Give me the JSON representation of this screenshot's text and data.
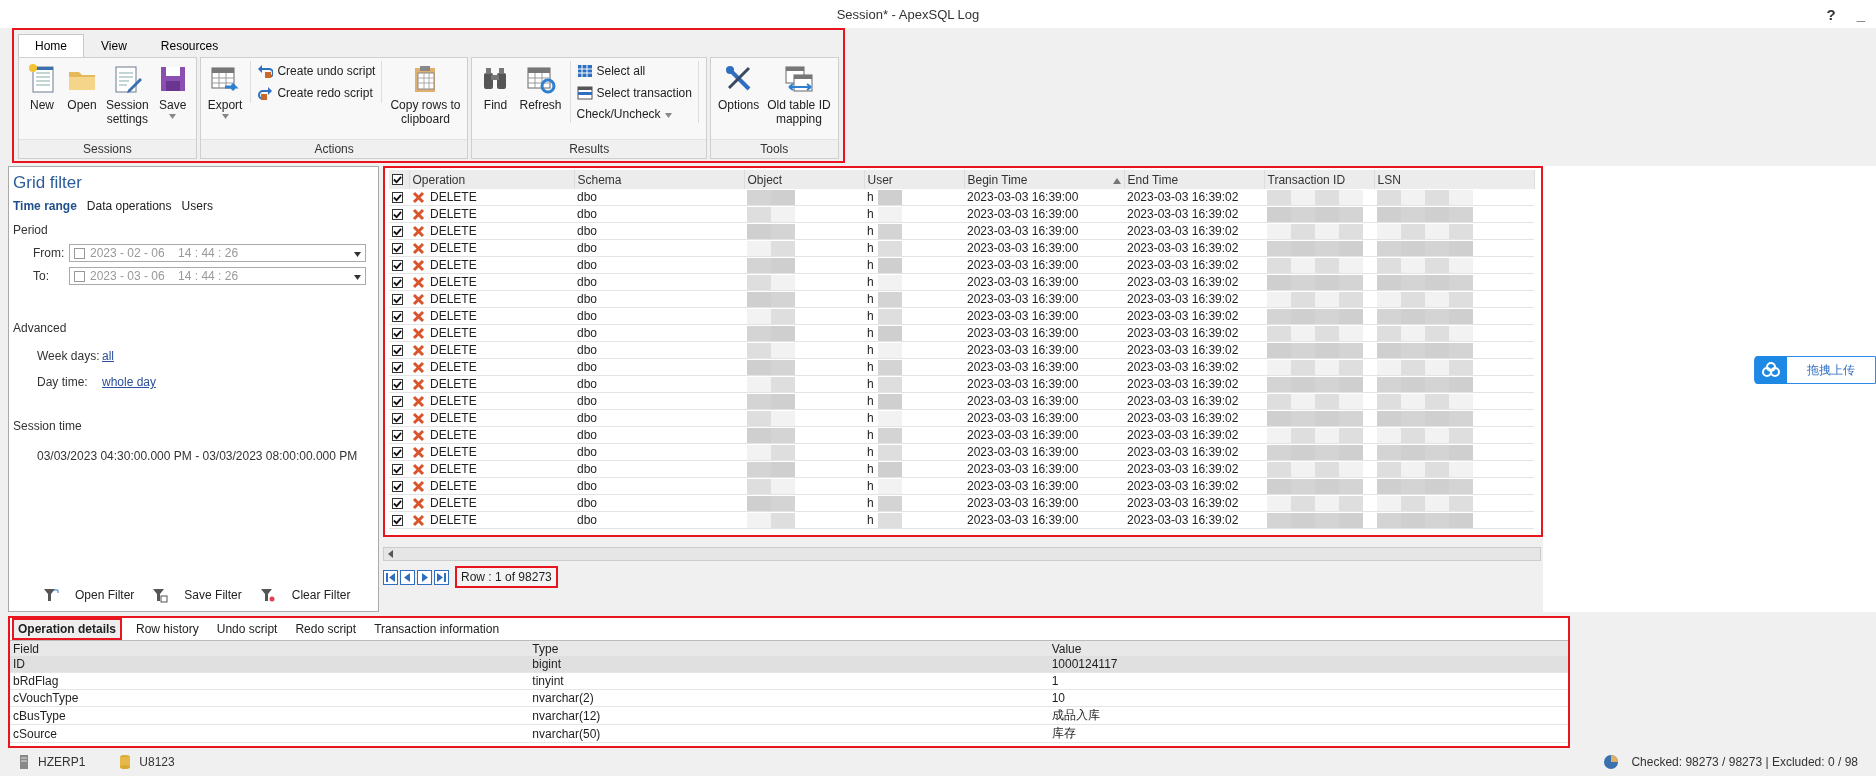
{
  "window": {
    "title": "Session* - ApexSQL Log",
    "help": "?",
    "minimize": "_"
  },
  "ribbon": {
    "tabs": [
      {
        "label": "Home",
        "selected": true
      },
      {
        "label": "View",
        "selected": false
      },
      {
        "label": "Resources",
        "selected": false
      }
    ],
    "groups": [
      {
        "name": "Sessions",
        "items": [
          {
            "kind": "large",
            "label": "New"
          },
          {
            "kind": "large",
            "label": "Open"
          },
          {
            "kind": "large",
            "label": "Session\nsettings"
          },
          {
            "kind": "large",
            "label": "Save",
            "has_menu": true
          }
        ]
      },
      {
        "name": "Actions",
        "items": [
          {
            "kind": "large",
            "label": "Export",
            "has_menu": true
          },
          {
            "kind": "stack",
            "items": [
              {
                "label": "Create undo script"
              },
              {
                "label": "Create redo script"
              }
            ]
          },
          {
            "kind": "large",
            "label": "Copy rows to\nclipboard"
          }
        ]
      },
      {
        "name": "Results",
        "items": [
          {
            "kind": "large",
            "label": "Find"
          },
          {
            "kind": "large",
            "label": "Refresh"
          },
          {
            "kind": "stack",
            "items": [
              {
                "label": "Select all"
              },
              {
                "label": "Select transaction"
              },
              {
                "label": "Check/Uncheck",
                "has_menu": true
              }
            ]
          }
        ]
      },
      {
        "name": "Tools",
        "items": [
          {
            "kind": "large",
            "label": "Options"
          },
          {
            "kind": "large",
            "label": "Old table ID\nmapping"
          }
        ]
      }
    ]
  },
  "filter": {
    "title": "Grid filter",
    "tabs": [
      {
        "label": "Time range",
        "selected": true
      },
      {
        "label": "Data operations",
        "selected": false
      },
      {
        "label": "Users",
        "selected": false
      }
    ],
    "period_label": "Period",
    "period": [
      {
        "label": "From:",
        "checked": false,
        "disabled": true,
        "value": "2023 - 02 - 06    14 : 44 : 26"
      },
      {
        "label": "To:",
        "checked": false,
        "disabled": true,
        "value": "2023 - 03 - 06    14 : 44 : 26"
      }
    ],
    "advanced_label": "Advanced",
    "advanced": [
      {
        "label": "Week days:",
        "link": "all"
      },
      {
        "label": "Day time:",
        "link": "whole day"
      }
    ],
    "session_label": "Session time",
    "session_time": "03/03/2023 04:30:00.000 PM - 03/03/2023 08:00:00.000 PM",
    "actions": [
      "Open Filter",
      "Save Filter",
      "Clear Filter"
    ]
  },
  "grid": {
    "all_checked": true,
    "columns": [
      {
        "label": "Operation"
      },
      {
        "label": "Schema"
      },
      {
        "label": "Object"
      },
      {
        "label": "User"
      },
      {
        "label": "Begin Time",
        "sorted": true
      },
      {
        "label": "End Time"
      },
      {
        "label": "Transaction ID"
      },
      {
        "label": "LSN"
      }
    ],
    "rows": [
      {
        "checked": true,
        "operation": "DELETE",
        "schema": "dbo",
        "user": "h",
        "begin": "2023-03-03 16:39:00",
        "end": "2023-03-03 16:39:02"
      },
      {
        "checked": true,
        "operation": "DELETE",
        "schema": "dbo",
        "user": "h",
        "begin": "2023-03-03 16:39:00",
        "end": "2023-03-03 16:39:02"
      },
      {
        "checked": true,
        "operation": "DELETE",
        "schema": "dbo",
        "user": "h",
        "begin": "2023-03-03 16:39:00",
        "end": "2023-03-03 16:39:02"
      },
      {
        "checked": true,
        "operation": "DELETE",
        "schema": "dbo",
        "user": "h",
        "begin": "2023-03-03 16:39:00",
        "end": "2023-03-03 16:39:02"
      },
      {
        "checked": true,
        "operation": "DELETE",
        "schema": "dbo",
        "user": "h",
        "begin": "2023-03-03 16:39:00",
        "end": "2023-03-03 16:39:02"
      },
      {
        "checked": true,
        "operation": "DELETE",
        "schema": "dbo",
        "user": "h",
        "begin": "2023-03-03 16:39:00",
        "end": "2023-03-03 16:39:02"
      },
      {
        "checked": true,
        "operation": "DELETE",
        "schema": "dbo",
        "user": "h",
        "begin": "2023-03-03 16:39:00",
        "end": "2023-03-03 16:39:02"
      },
      {
        "checked": true,
        "operation": "DELETE",
        "schema": "dbo",
        "user": "h",
        "begin": "2023-03-03 16:39:00",
        "end": "2023-03-03 16:39:02"
      },
      {
        "checked": true,
        "operation": "DELETE",
        "schema": "dbo",
        "user": "h",
        "begin": "2023-03-03 16:39:00",
        "end": "2023-03-03 16:39:02"
      },
      {
        "checked": true,
        "operation": "DELETE",
        "schema": "dbo",
        "user": "h",
        "begin": "2023-03-03 16:39:00",
        "end": "2023-03-03 16:39:02"
      },
      {
        "checked": true,
        "operation": "DELETE",
        "schema": "dbo",
        "user": "h",
        "begin": "2023-03-03 16:39:00",
        "end": "2023-03-03 16:39:02"
      },
      {
        "checked": true,
        "operation": "DELETE",
        "schema": "dbo",
        "user": "h",
        "begin": "2023-03-03 16:39:00",
        "end": "2023-03-03 16:39:02"
      },
      {
        "checked": true,
        "operation": "DELETE",
        "schema": "dbo",
        "user": "h",
        "begin": "2023-03-03 16:39:00",
        "end": "2023-03-03 16:39:02"
      },
      {
        "checked": true,
        "operation": "DELETE",
        "schema": "dbo",
        "user": "h",
        "begin": "2023-03-03 16:39:00",
        "end": "2023-03-03 16:39:02"
      },
      {
        "checked": true,
        "operation": "DELETE",
        "schema": "dbo",
        "user": "h",
        "begin": "2023-03-03 16:39:00",
        "end": "2023-03-03 16:39:02"
      },
      {
        "checked": true,
        "operation": "DELETE",
        "schema": "dbo",
        "user": "h",
        "begin": "2023-03-03 16:39:00",
        "end": "2023-03-03 16:39:02"
      },
      {
        "checked": true,
        "operation": "DELETE",
        "schema": "dbo",
        "user": "h",
        "begin": "2023-03-03 16:39:00",
        "end": "2023-03-03 16:39:02"
      },
      {
        "checked": true,
        "operation": "DELETE",
        "schema": "dbo",
        "user": "h",
        "begin": "2023-03-03 16:39:00",
        "end": "2023-03-03 16:39:02"
      },
      {
        "checked": true,
        "operation": "DELETE",
        "schema": "dbo",
        "user": "h",
        "begin": "2023-03-03 16:39:00",
        "end": "2023-03-03 16:39:02"
      },
      {
        "checked": true,
        "operation": "DELETE",
        "schema": "dbo",
        "user": "h",
        "begin": "2023-03-03 16:39:00",
        "end": "2023-03-03 16:39:02"
      }
    ]
  },
  "navigator": {
    "row_info": "Row : 1 of 98273"
  },
  "details": {
    "tabs": [
      {
        "label": "Operation details",
        "selected": true
      },
      {
        "label": "Row history",
        "selected": false
      },
      {
        "label": "Undo script",
        "selected": false
      },
      {
        "label": "Redo script",
        "selected": false
      },
      {
        "label": "Transaction information",
        "selected": false
      }
    ],
    "columns": [
      "Field",
      "Type",
      "Value"
    ],
    "rows": [
      {
        "field": "ID",
        "type": "bigint",
        "value": "1000124117",
        "selected": true
      },
      {
        "field": "bRdFlag",
        "type": "tinyint",
        "value": "1",
        "selected": false
      },
      {
        "field": "cVouchType",
        "type": "nvarchar(2)",
        "value": "10",
        "selected": false
      },
      {
        "field": "cBusType",
        "type": "nvarchar(12)",
        "value": "成品入库",
        "selected": false
      },
      {
        "field": "cSource",
        "type": "nvarchar(50)",
        "value": "库存",
        "selected": false
      }
    ]
  },
  "upload_button": {
    "label": "拖拽上传"
  },
  "status_bar": {
    "server": "HZERP1",
    "database": "U8123",
    "summary": "Checked: 98273 / 98273 | Excluded: 0 / 98"
  }
}
